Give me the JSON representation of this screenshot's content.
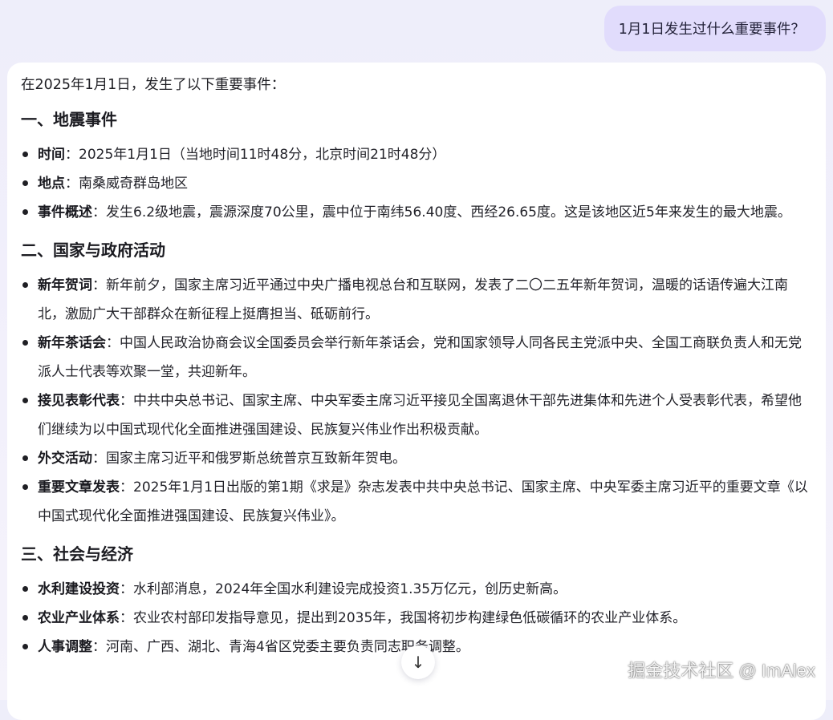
{
  "user_message": "1月1日发生过什么重要事件？",
  "answer": {
    "intro": "在2025年1月1日，发生了以下重要事件：",
    "sections": [
      {
        "heading": "一、地震事件",
        "items": [
          {
            "term": "时间",
            "sep": "：",
            "text": "2025年1月1日（当地时间11时48分，北京时间21时48分）"
          },
          {
            "term": "地点",
            "sep": "：",
            "text": "南桑威奇群岛地区"
          },
          {
            "term": "事件概述",
            "sep": "：",
            "text": "发生6.2级地震，震源深度70公里，震中位于南纬56.40度、西经26.65度。这是该地区近5年来发生的最大地震。"
          }
        ]
      },
      {
        "heading": "二、国家与政府活动",
        "items": [
          {
            "term": "新年贺词",
            "sep": "：",
            "text": "新年前夕，国家主席习近平通过中央广播电视总台和互联网，发表了二〇二五年新年贺词，温暖的话语传遍大江南北，激励广大干部群众在新征程上挺膺担当、砥砺前行。"
          },
          {
            "term": "新年茶话会",
            "sep": "：",
            "text": "中国人民政治协商会议全国委员会举行新年茶话会，党和国家领导人同各民主党派中央、全国工商联负责人和无党派人士代表等欢聚一堂，共迎新年。"
          },
          {
            "term": "接见表彰代表",
            "sep": "：",
            "text": "中共中央总书记、国家主席、中央军委主席习近平接见全国离退休干部先进集体和先进个人受表彰代表，希望他们继续为以中国式现代化全面推进强国建设、民族复兴伟业作出积极贡献。"
          },
          {
            "term": "外交活动",
            "sep": "：",
            "text": "国家主席习近平和俄罗斯总统普京互致新年贺电。"
          },
          {
            "term": "重要文章发表",
            "sep": "：",
            "text": "2025年1月1日出版的第1期《求是》杂志发表中共中央总书记、国家主席、中央军委主席习近平的重要文章《以中国式现代化全面推进强国建设、民族复兴伟业》。"
          }
        ]
      },
      {
        "heading": "三、社会与经济",
        "items": [
          {
            "term": "水利建设投资",
            "sep": "：",
            "text": "水利部消息，2024年全国水利建设完成投资1.35万亿元，创历史新高。"
          },
          {
            "term": "农业产业体系",
            "sep": "：",
            "text": "农业农村部印发指导意见，提出到2035年，我国将初步构建绿色低碳循环的农业产业体系。"
          },
          {
            "term": "人事调整",
            "sep": "：",
            "text": "河南、广西、湖北、青海4省区党委主要负责同志职务调整。"
          }
        ]
      }
    ]
  },
  "scroll_button_icon": "arrow-down-icon",
  "scroll_button_glyph": "↓",
  "watermark": "掘金技术社区 @ ImAlex"
}
